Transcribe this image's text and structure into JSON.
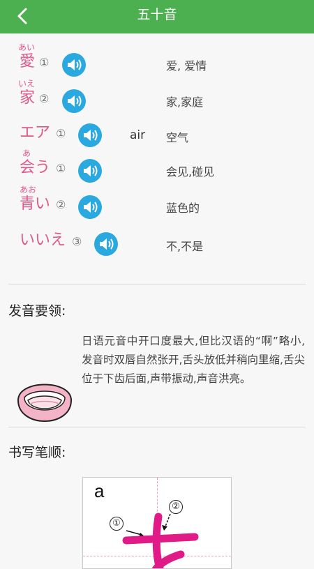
{
  "header": {
    "title": "五十音"
  },
  "words": [
    {
      "furigana": "あい",
      "word": "愛",
      "accent": "①",
      "romaji": "",
      "meaning": "爱, 爱情"
    },
    {
      "furigana": "いえ",
      "word": "家",
      "accent": "②",
      "romaji": "",
      "meaning": "家,家庭"
    },
    {
      "furigana": "",
      "word": "エア",
      "accent": "①",
      "romaji": "air",
      "meaning": "空气"
    },
    {
      "furigana": "あ",
      "word": "会う",
      "accent": "①",
      "romaji": "",
      "meaning": "会见,碰见"
    },
    {
      "furigana": "あお",
      "word": "青い",
      "accent": "②",
      "romaji": "",
      "meaning": "蓝色的"
    },
    {
      "furigana": "",
      "word": "いいえ",
      "accent": "③",
      "romaji": "",
      "meaning": "不,不是"
    }
  ],
  "pronunciation": {
    "heading": "发音要领:",
    "text": "日语元音中开口度最大,但比汉语的“啊”略小,发音时双唇自然张开,舌头放低并稍向里缩,舌尖位于下齿后面,声带振动,声音洪亮。"
  },
  "stroke_order": {
    "heading": "书写笔顺:",
    "letter": "a",
    "step1": "①",
    "step2": "②"
  },
  "colors": {
    "header": "#4caf50",
    "accent": "#e0588a",
    "speaker": "#2aa9e0"
  },
  "icons": {
    "back": "chevron-left-icon",
    "speaker": "speaker-icon",
    "mouth": "mouth-illustration"
  }
}
